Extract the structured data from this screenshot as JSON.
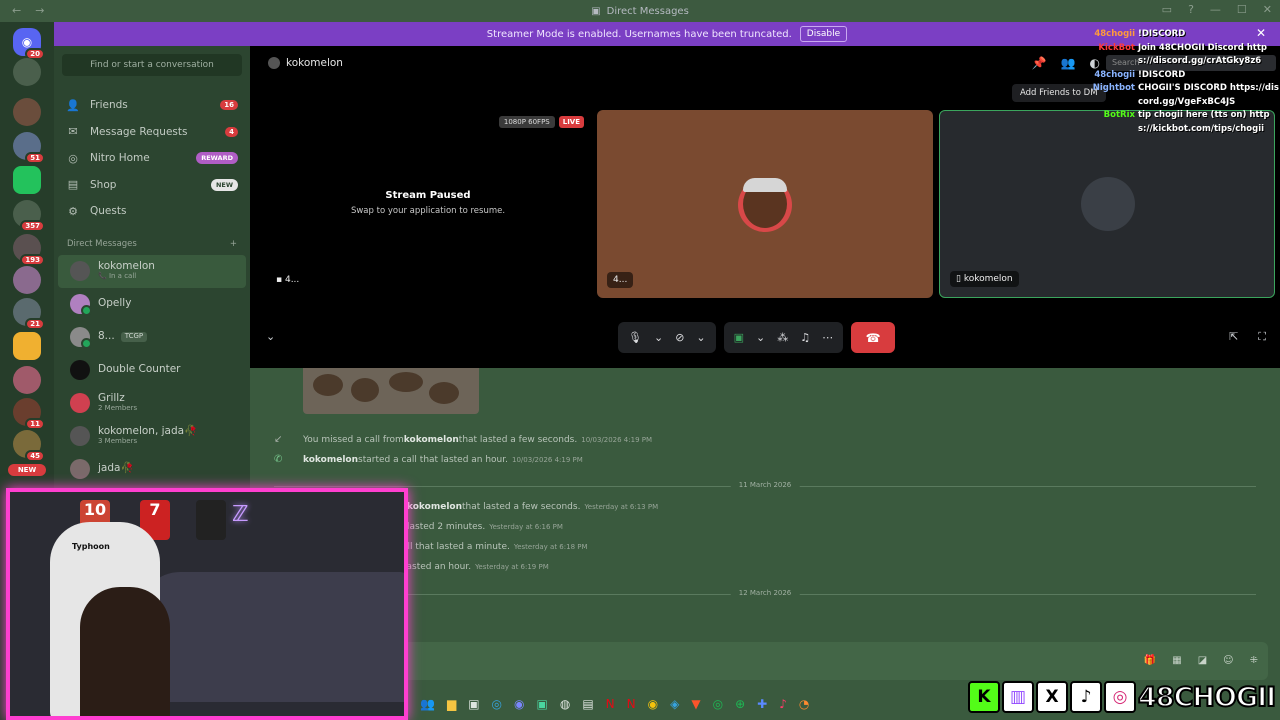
{
  "window": {
    "title": "Direct Messages"
  },
  "banner": {
    "text": "Streamer Mode is enabled. Usernames have been truncated.",
    "button": "Disable",
    "close": "✕"
  },
  "rail": {
    "badges": [
      "20",
      "51",
      "357",
      "193",
      "21",
      "11",
      "45"
    ],
    "new_label": "NEW"
  },
  "sidebar": {
    "search_placeholder": "Find or start a conversation",
    "nav": [
      {
        "label": "Friends",
        "count": "16"
      },
      {
        "label": "Message Requests",
        "count": "4"
      },
      {
        "label": "Nitro Home",
        "pill": "REWARD"
      },
      {
        "label": "Shop",
        "pill": "NEW"
      },
      {
        "label": "Quests"
      }
    ],
    "dm_header": "Direct Messages",
    "dm_add": "+",
    "dms": [
      {
        "name": "kokomelon",
        "sub": "In a call"
      },
      {
        "name": "Opelly",
        "sub": ""
      },
      {
        "name": "8...",
        "tag": "TCGP"
      },
      {
        "name": "Double Counter",
        "sub": ""
      },
      {
        "name": "Grillz",
        "sub": "2 Members"
      },
      {
        "name": "kokomelon, jada🥀",
        "sub": "3 Members"
      },
      {
        "name": "jada🥀",
        "sub": ""
      }
    ]
  },
  "call": {
    "title": "kokomelon",
    "tooltip": "Add Friends to DM",
    "stream": {
      "quality": "1080P 60FPS",
      "live": "LIVE",
      "paused_title": "Stream Paused",
      "paused_sub": "Swap to your application to resume.",
      "label": "4..."
    },
    "tile1": {
      "label": "4..."
    },
    "tile2": {
      "label": "kokomelon"
    }
  },
  "chat": {
    "messages": [
      {
        "pre": "You missed a call from ",
        "who": "kokomelon",
        "post": " that lasted a few seconds.",
        "time": "10/03/2026 4:19 PM",
        "missed": true
      },
      {
        "pre": "",
        "who": "kokomelon",
        "post": " started a call that lasted an hour.",
        "time": "10/03/2026 4:19 PM",
        "missed": false
      }
    ],
    "divider1": "11 March 2026",
    "partial": [
      {
        "who": "kokomelon",
        "post": " that lasted a few seconds.",
        "time": "Yesterday at 6:13 PM"
      },
      {
        "who": "",
        "post": "lasted 2 minutes.",
        "time": "Yesterday at 6:16 PM"
      },
      {
        "who": "",
        "post": "all that lasted a minute.",
        "time": "Yesterday at 6:18 PM"
      },
      {
        "who": "",
        "post": "lasted an hour.",
        "time": "Yesterday at 6:19 PM"
      }
    ],
    "divider2": "12 March 2026"
  },
  "overlay": {
    "search": "Search",
    "lines": [
      {
        "user": "48chogii",
        "color": "#ff9a3c",
        "msg": "!DISCORD"
      },
      {
        "user": "KickBot",
        "color": "#ff3a3a",
        "msg": "Join 48CHOGII Discord https://discord.gg/crAtGky8z6"
      },
      {
        "user": "48chogii",
        "color": "#8ab4ff",
        "msg": "!DISCORD"
      },
      {
        "user": "Nightbot",
        "color": "#8ab4ff",
        "msg": "CHOGII'S DISCORD https://discord.gg/VgeFxBC4JS"
      },
      {
        "user": "BotRix",
        "color": "#53fc18",
        "msg": "tip chogii here (tts on) https://kickbot.com/tips/chogii"
      }
    ]
  },
  "webcam": {
    "chair_brand": "Typhoon",
    "jersey1": "10",
    "jersey2": "7"
  },
  "socials": {
    "handle": "48CHOGII"
  }
}
